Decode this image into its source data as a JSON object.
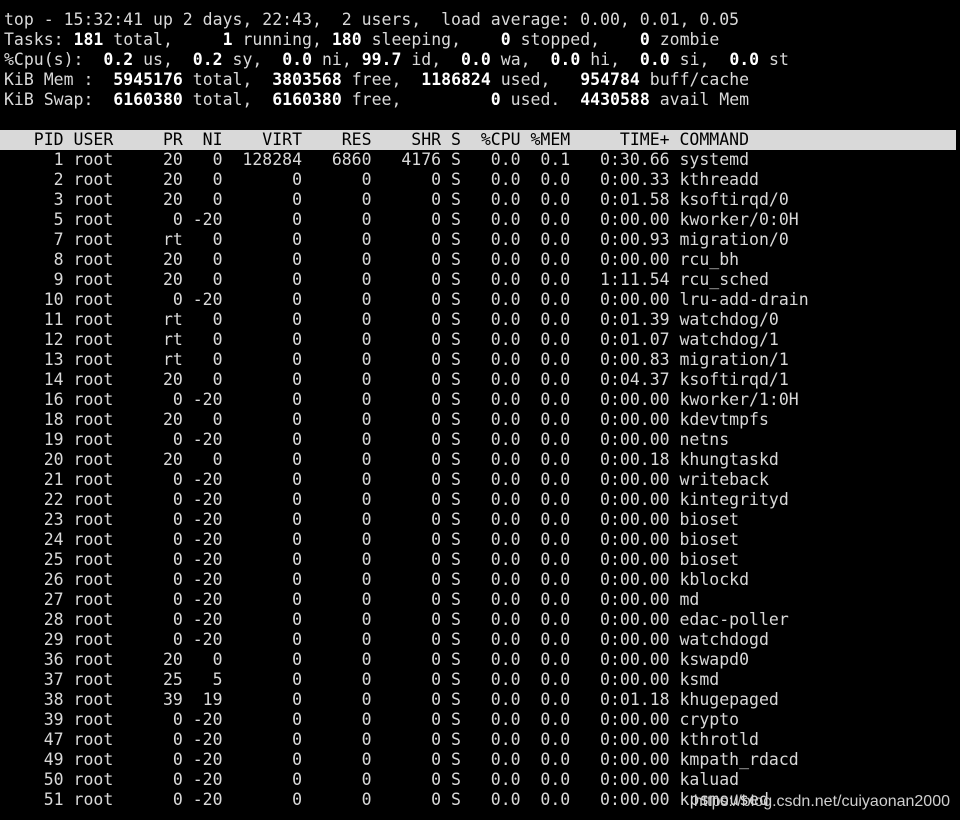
{
  "summary": {
    "line1": "top - 15:32:41 up 2 days, 22:43,  2 users,  load average: 0.00, 0.01, 0.05",
    "tasks": {
      "label": "Tasks:",
      "total": "181",
      "running": "1",
      "sleeping": "180",
      "stopped": "0",
      "zombie": "0"
    },
    "cpu": {
      "label": "%Cpu(s):",
      "us": "0.2",
      "sy": "0.2",
      "ni": "0.0",
      "id": "99.7",
      "wa": "0.0",
      "hi": "0.0",
      "si": "0.0",
      "st": "0.0"
    },
    "mem": {
      "label": "KiB Mem :",
      "total": "5945176",
      "free": "3803568",
      "used": "1186824",
      "buffcache": "954784"
    },
    "swap": {
      "label": "KiB Swap:",
      "total": "6160380",
      "free": "6160380",
      "used": "0",
      "avail": "4430588"
    }
  },
  "columns": [
    "PID",
    "USER",
    "PR",
    "NI",
    "VIRT",
    "RES",
    "SHR",
    "S",
    "%CPU",
    "%MEM",
    "TIME+",
    "COMMAND"
  ],
  "processes": [
    [
      "1",
      "root",
      "20",
      "0",
      "128284",
      "6860",
      "4176",
      "S",
      "0.0",
      "0.1",
      "0:30.66",
      "systemd"
    ],
    [
      "2",
      "root",
      "20",
      "0",
      "0",
      "0",
      "0",
      "S",
      "0.0",
      "0.0",
      "0:00.33",
      "kthreadd"
    ],
    [
      "3",
      "root",
      "20",
      "0",
      "0",
      "0",
      "0",
      "S",
      "0.0",
      "0.0",
      "0:01.58",
      "ksoftirqd/0"
    ],
    [
      "5",
      "root",
      "0",
      "-20",
      "0",
      "0",
      "0",
      "S",
      "0.0",
      "0.0",
      "0:00.00",
      "kworker/0:0H"
    ],
    [
      "7",
      "root",
      "rt",
      "0",
      "0",
      "0",
      "0",
      "S",
      "0.0",
      "0.0",
      "0:00.93",
      "migration/0"
    ],
    [
      "8",
      "root",
      "20",
      "0",
      "0",
      "0",
      "0",
      "S",
      "0.0",
      "0.0",
      "0:00.00",
      "rcu_bh"
    ],
    [
      "9",
      "root",
      "20",
      "0",
      "0",
      "0",
      "0",
      "S",
      "0.0",
      "0.0",
      "1:11.54",
      "rcu_sched"
    ],
    [
      "10",
      "root",
      "0",
      "-20",
      "0",
      "0",
      "0",
      "S",
      "0.0",
      "0.0",
      "0:00.00",
      "lru-add-drain"
    ],
    [
      "11",
      "root",
      "rt",
      "0",
      "0",
      "0",
      "0",
      "S",
      "0.0",
      "0.0",
      "0:01.39",
      "watchdog/0"
    ],
    [
      "12",
      "root",
      "rt",
      "0",
      "0",
      "0",
      "0",
      "S",
      "0.0",
      "0.0",
      "0:01.07",
      "watchdog/1"
    ],
    [
      "13",
      "root",
      "rt",
      "0",
      "0",
      "0",
      "0",
      "S",
      "0.0",
      "0.0",
      "0:00.83",
      "migration/1"
    ],
    [
      "14",
      "root",
      "20",
      "0",
      "0",
      "0",
      "0",
      "S",
      "0.0",
      "0.0",
      "0:04.37",
      "ksoftirqd/1"
    ],
    [
      "16",
      "root",
      "0",
      "-20",
      "0",
      "0",
      "0",
      "S",
      "0.0",
      "0.0",
      "0:00.00",
      "kworker/1:0H"
    ],
    [
      "18",
      "root",
      "20",
      "0",
      "0",
      "0",
      "0",
      "S",
      "0.0",
      "0.0",
      "0:00.00",
      "kdevtmpfs"
    ],
    [
      "19",
      "root",
      "0",
      "-20",
      "0",
      "0",
      "0",
      "S",
      "0.0",
      "0.0",
      "0:00.00",
      "netns"
    ],
    [
      "20",
      "root",
      "20",
      "0",
      "0",
      "0",
      "0",
      "S",
      "0.0",
      "0.0",
      "0:00.18",
      "khungtaskd"
    ],
    [
      "21",
      "root",
      "0",
      "-20",
      "0",
      "0",
      "0",
      "S",
      "0.0",
      "0.0",
      "0:00.00",
      "writeback"
    ],
    [
      "22",
      "root",
      "0",
      "-20",
      "0",
      "0",
      "0",
      "S",
      "0.0",
      "0.0",
      "0:00.00",
      "kintegrityd"
    ],
    [
      "23",
      "root",
      "0",
      "-20",
      "0",
      "0",
      "0",
      "S",
      "0.0",
      "0.0",
      "0:00.00",
      "bioset"
    ],
    [
      "24",
      "root",
      "0",
      "-20",
      "0",
      "0",
      "0",
      "S",
      "0.0",
      "0.0",
      "0:00.00",
      "bioset"
    ],
    [
      "25",
      "root",
      "0",
      "-20",
      "0",
      "0",
      "0",
      "S",
      "0.0",
      "0.0",
      "0:00.00",
      "bioset"
    ],
    [
      "26",
      "root",
      "0",
      "-20",
      "0",
      "0",
      "0",
      "S",
      "0.0",
      "0.0",
      "0:00.00",
      "kblockd"
    ],
    [
      "27",
      "root",
      "0",
      "-20",
      "0",
      "0",
      "0",
      "S",
      "0.0",
      "0.0",
      "0:00.00",
      "md"
    ],
    [
      "28",
      "root",
      "0",
      "-20",
      "0",
      "0",
      "0",
      "S",
      "0.0",
      "0.0",
      "0:00.00",
      "edac-poller"
    ],
    [
      "29",
      "root",
      "0",
      "-20",
      "0",
      "0",
      "0",
      "S",
      "0.0",
      "0.0",
      "0:00.00",
      "watchdogd"
    ],
    [
      "36",
      "root",
      "20",
      "0",
      "0",
      "0",
      "0",
      "S",
      "0.0",
      "0.0",
      "0:00.00",
      "kswapd0"
    ],
    [
      "37",
      "root",
      "25",
      "5",
      "0",
      "0",
      "0",
      "S",
      "0.0",
      "0.0",
      "0:00.00",
      "ksmd"
    ],
    [
      "38",
      "root",
      "39",
      "19",
      "0",
      "0",
      "0",
      "S",
      "0.0",
      "0.0",
      "0:01.18",
      "khugepaged"
    ],
    [
      "39",
      "root",
      "0",
      "-20",
      "0",
      "0",
      "0",
      "S",
      "0.0",
      "0.0",
      "0:00.00",
      "crypto"
    ],
    [
      "47",
      "root",
      "0",
      "-20",
      "0",
      "0",
      "0",
      "S",
      "0.0",
      "0.0",
      "0:00.00",
      "kthrotld"
    ],
    [
      "49",
      "root",
      "0",
      "-20",
      "0",
      "0",
      "0",
      "S",
      "0.0",
      "0.0",
      "0:00.00",
      "kmpath_rdacd"
    ],
    [
      "50",
      "root",
      "0",
      "-20",
      "0",
      "0",
      "0",
      "S",
      "0.0",
      "0.0",
      "0:00.00",
      "kaluad"
    ],
    [
      "51",
      "root",
      "0",
      "-20",
      "0",
      "0",
      "0",
      "S",
      "0.0",
      "0.0",
      "0:00.00",
      "kpsmoused"
    ]
  ],
  "watermark": "https://blog.csdn.net/cuiyaonan2000"
}
